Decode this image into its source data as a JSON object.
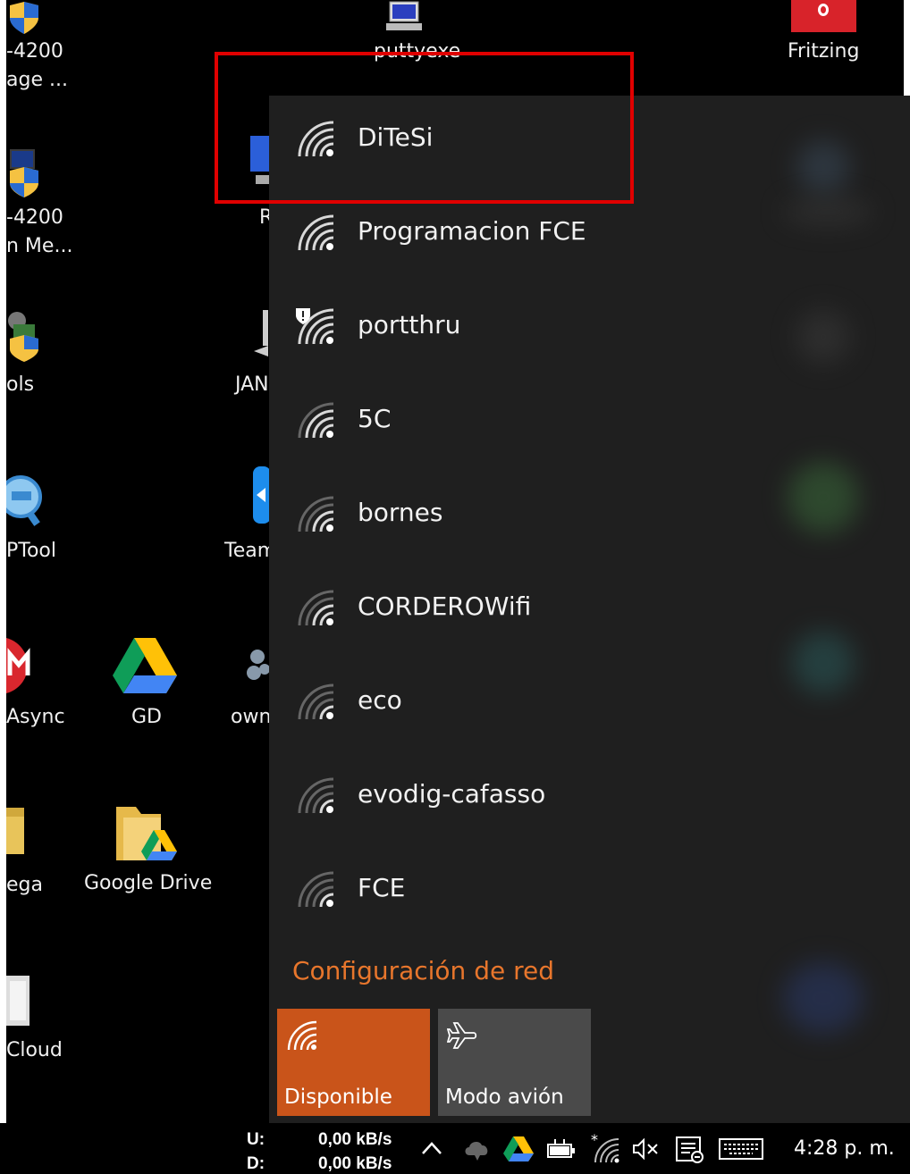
{
  "desktop": {
    "icons": [
      {
        "label": "-4200"
      },
      {
        "label": "age ..."
      },
      {
        "label": "puttyexe"
      },
      {
        "label": "Fritzing"
      },
      {
        "label": "-4200"
      },
      {
        "label": "n Me..."
      },
      {
        "label": "R"
      },
      {
        "label": "ols"
      },
      {
        "label": "JAN"
      },
      {
        "label": "PTool"
      },
      {
        "label": "Team"
      },
      {
        "label": "Async"
      },
      {
        "label": "GD"
      },
      {
        "label": "own"
      },
      {
        "label": "ega"
      },
      {
        "label": "Google Drive"
      },
      {
        "label": "Cloud"
      }
    ]
  },
  "wifi_flyout": {
    "networks": [
      {
        "name": "DiTeSi",
        "secured": true,
        "warning": false
      },
      {
        "name": "Programacion FCE",
        "secured": true,
        "warning": false
      },
      {
        "name": "portthru",
        "secured": false,
        "warning": true
      },
      {
        "name": "5C",
        "secured": true,
        "warning": false
      },
      {
        "name": "bornes",
        "secured": true,
        "warning": false
      },
      {
        "name": "CORDEROWifi",
        "secured": true,
        "warning": false
      },
      {
        "name": "eco",
        "secured": true,
        "warning": false
      },
      {
        "name": "evodig-cafasso",
        "secured": true,
        "warning": false
      },
      {
        "name": "FCE",
        "secured": true,
        "warning": false
      }
    ],
    "settings_link": "Configuración de red",
    "tiles": [
      {
        "label": "Disponible",
        "icon": "wifi-icon",
        "active": true,
        "color": "#c9541a"
      },
      {
        "label": "Modo avión",
        "icon": "airplane-icon",
        "active": false,
        "color": "#4a4a4a"
      }
    ]
  },
  "taskbar": {
    "net_speed": {
      "upload_label": "U:",
      "upload_value": "0,00 kB/s",
      "download_label": "D:",
      "download_value": "0,00 kB/s"
    },
    "tray_icons": [
      "chevron-up-icon",
      "cloud-sync-icon",
      "google-drive-icon",
      "battery-icon",
      "wifi-icon",
      "volume-muted-icon",
      "action-center-icon",
      "keyboard-icon"
    ],
    "clock": "4:28 p. m."
  },
  "colors": {
    "accent": "#e8762c",
    "highlight_box": "#e00000"
  }
}
